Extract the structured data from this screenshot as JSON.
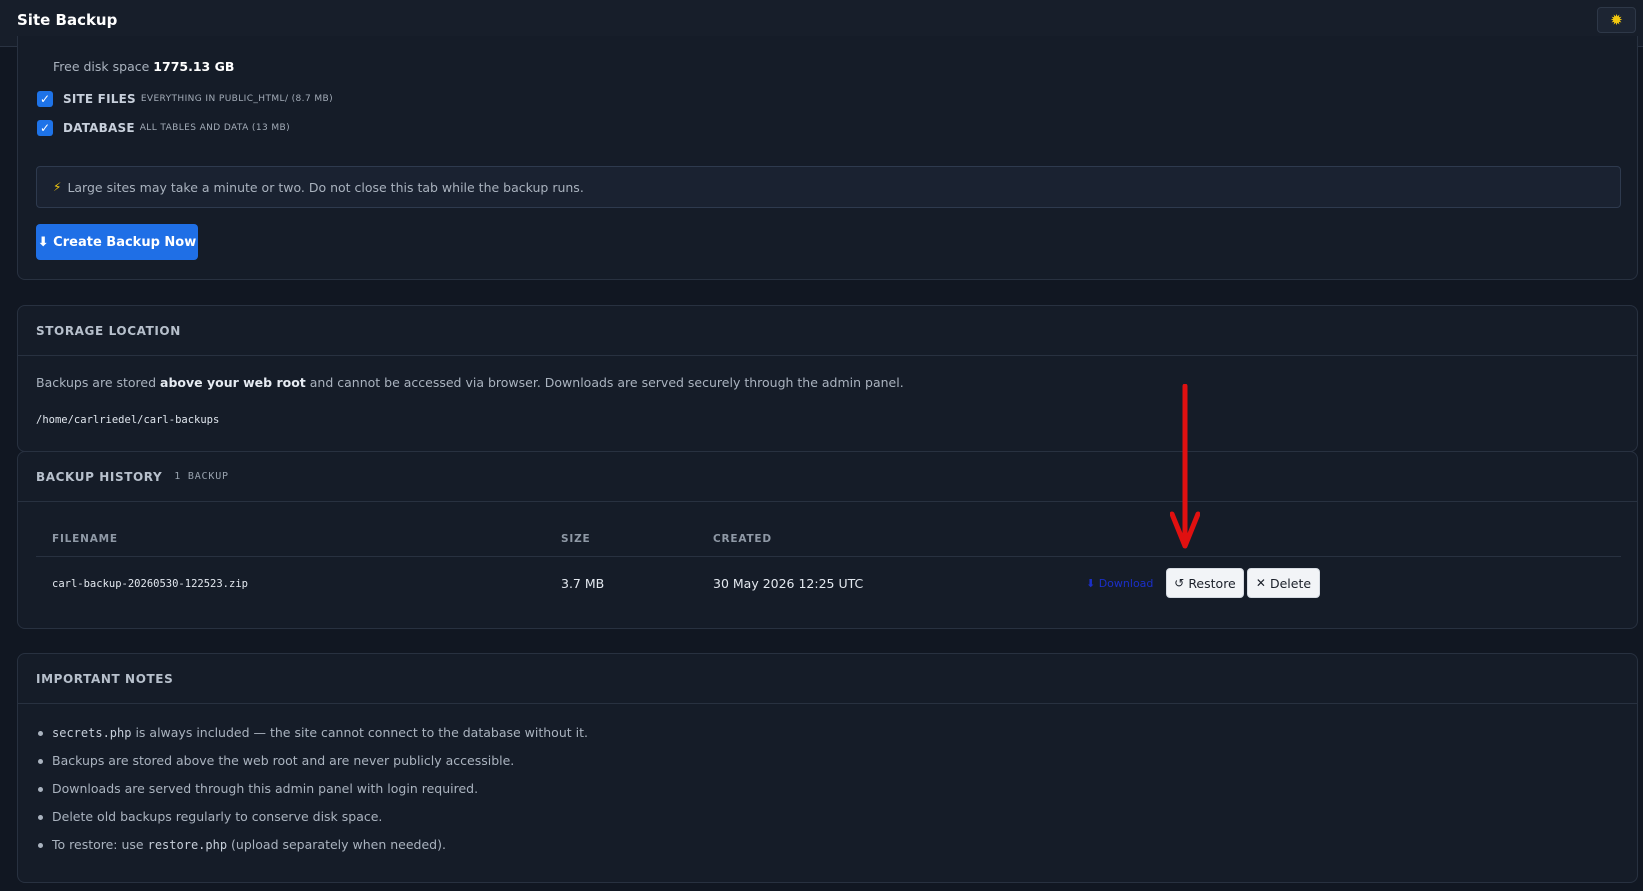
{
  "header": {
    "title": "Site Backup",
    "theme_icon": "sun-icon"
  },
  "backup_form": {
    "free_disk_label": "Free disk space",
    "free_disk_value": "1775.13 GB",
    "options": [
      {
        "label": "SITE FILES",
        "desc": "EVERYTHING IN PUBLIC_HTML/ (8.7 MB)",
        "checked": true
      },
      {
        "label": "DATABASE",
        "desc": "ALL TABLES AND DATA (13 MB)",
        "checked": true
      }
    ],
    "info_icon": "lightning-icon",
    "info_text": "Large sites may take a minute or two. Do not close this tab while the backup runs.",
    "create_button": "⬇ Create Backup Now"
  },
  "storage": {
    "title": "STORAGE LOCATION",
    "text_before": "Backups are stored ",
    "text_bold": "above your web root",
    "text_after": " and cannot be accessed via browser. Downloads are served securely through the admin panel.",
    "path": "/home/carlriedel/carl-backups"
  },
  "history": {
    "title": "BACKUP HISTORY",
    "count": "1 BACKUP",
    "columns": [
      "FILENAME",
      "SIZE",
      "CREATED"
    ],
    "rows": [
      {
        "filename": "carl-backup-20260530-122523.zip",
        "size": "3.7 MB",
        "created": "30 May 2026 12:25 UTC",
        "download": "⬇ Download",
        "restore": "Restore",
        "delete": "Delete"
      }
    ]
  },
  "notes": {
    "title": "IMPORTANT NOTES",
    "items": [
      {
        "code": "secrets.php",
        "text": " is always included — the site cannot connect to the database without it."
      },
      {
        "text": "Backups are stored above the web root and are never publicly accessible."
      },
      {
        "text": "Downloads are served through this admin panel with login required."
      },
      {
        "text": "Delete old backups regularly to conserve disk space."
      },
      {
        "prefix": "To restore: use ",
        "code": "restore.php",
        "text": " (upload separately when needed)."
      }
    ]
  },
  "colors": {
    "accent": "#1f6fe6",
    "background": "#111722",
    "annotation_arrow": "#e01010"
  }
}
